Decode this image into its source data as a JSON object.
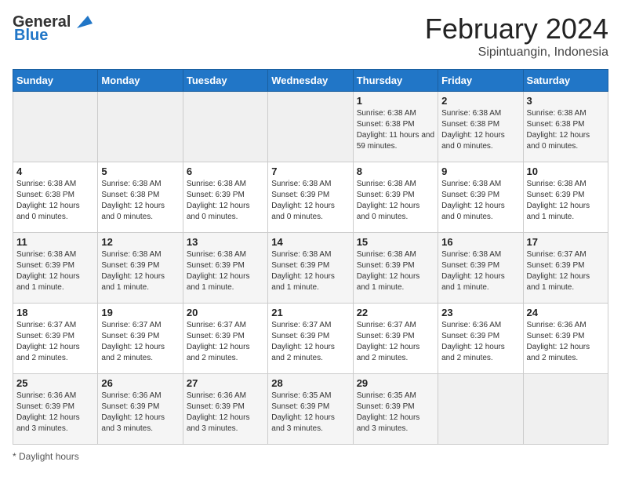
{
  "header": {
    "logo_general": "General",
    "logo_blue": "Blue",
    "month_title": "February 2024",
    "location": "Sipintuangin, Indonesia"
  },
  "days_of_week": [
    "Sunday",
    "Monday",
    "Tuesday",
    "Wednesday",
    "Thursday",
    "Friday",
    "Saturday"
  ],
  "footer": {
    "daylight_label": "Daylight hours"
  },
  "weeks": [
    [
      {
        "day": "",
        "sunrise": "",
        "sunset": "",
        "daylight": "",
        "empty": true
      },
      {
        "day": "",
        "sunrise": "",
        "sunset": "",
        "daylight": "",
        "empty": true
      },
      {
        "day": "",
        "sunrise": "",
        "sunset": "",
        "daylight": "",
        "empty": true
      },
      {
        "day": "",
        "sunrise": "",
        "sunset": "",
        "daylight": "",
        "empty": true
      },
      {
        "day": "1",
        "sunrise": "Sunrise: 6:38 AM",
        "sunset": "Sunset: 6:38 PM",
        "daylight": "Daylight: 11 hours and 59 minutes.",
        "empty": false
      },
      {
        "day": "2",
        "sunrise": "Sunrise: 6:38 AM",
        "sunset": "Sunset: 6:38 PM",
        "daylight": "Daylight: 12 hours and 0 minutes.",
        "empty": false
      },
      {
        "day": "3",
        "sunrise": "Sunrise: 6:38 AM",
        "sunset": "Sunset: 6:38 PM",
        "daylight": "Daylight: 12 hours and 0 minutes.",
        "empty": false
      }
    ],
    [
      {
        "day": "4",
        "sunrise": "Sunrise: 6:38 AM",
        "sunset": "Sunset: 6:38 PM",
        "daylight": "Daylight: 12 hours and 0 minutes.",
        "empty": false
      },
      {
        "day": "5",
        "sunrise": "Sunrise: 6:38 AM",
        "sunset": "Sunset: 6:38 PM",
        "daylight": "Daylight: 12 hours and 0 minutes.",
        "empty": false
      },
      {
        "day": "6",
        "sunrise": "Sunrise: 6:38 AM",
        "sunset": "Sunset: 6:39 PM",
        "daylight": "Daylight: 12 hours and 0 minutes.",
        "empty": false
      },
      {
        "day": "7",
        "sunrise": "Sunrise: 6:38 AM",
        "sunset": "Sunset: 6:39 PM",
        "daylight": "Daylight: 12 hours and 0 minutes.",
        "empty": false
      },
      {
        "day": "8",
        "sunrise": "Sunrise: 6:38 AM",
        "sunset": "Sunset: 6:39 PM",
        "daylight": "Daylight: 12 hours and 0 minutes.",
        "empty": false
      },
      {
        "day": "9",
        "sunrise": "Sunrise: 6:38 AM",
        "sunset": "Sunset: 6:39 PM",
        "daylight": "Daylight: 12 hours and 0 minutes.",
        "empty": false
      },
      {
        "day": "10",
        "sunrise": "Sunrise: 6:38 AM",
        "sunset": "Sunset: 6:39 PM",
        "daylight": "Daylight: 12 hours and 1 minute.",
        "empty": false
      }
    ],
    [
      {
        "day": "11",
        "sunrise": "Sunrise: 6:38 AM",
        "sunset": "Sunset: 6:39 PM",
        "daylight": "Daylight: 12 hours and 1 minute.",
        "empty": false
      },
      {
        "day": "12",
        "sunrise": "Sunrise: 6:38 AM",
        "sunset": "Sunset: 6:39 PM",
        "daylight": "Daylight: 12 hours and 1 minute.",
        "empty": false
      },
      {
        "day": "13",
        "sunrise": "Sunrise: 6:38 AM",
        "sunset": "Sunset: 6:39 PM",
        "daylight": "Daylight: 12 hours and 1 minute.",
        "empty": false
      },
      {
        "day": "14",
        "sunrise": "Sunrise: 6:38 AM",
        "sunset": "Sunset: 6:39 PM",
        "daylight": "Daylight: 12 hours and 1 minute.",
        "empty": false
      },
      {
        "day": "15",
        "sunrise": "Sunrise: 6:38 AM",
        "sunset": "Sunset: 6:39 PM",
        "daylight": "Daylight: 12 hours and 1 minute.",
        "empty": false
      },
      {
        "day": "16",
        "sunrise": "Sunrise: 6:38 AM",
        "sunset": "Sunset: 6:39 PM",
        "daylight": "Daylight: 12 hours and 1 minute.",
        "empty": false
      },
      {
        "day": "17",
        "sunrise": "Sunrise: 6:37 AM",
        "sunset": "Sunset: 6:39 PM",
        "daylight": "Daylight: 12 hours and 1 minute.",
        "empty": false
      }
    ],
    [
      {
        "day": "18",
        "sunrise": "Sunrise: 6:37 AM",
        "sunset": "Sunset: 6:39 PM",
        "daylight": "Daylight: 12 hours and 2 minutes.",
        "empty": false
      },
      {
        "day": "19",
        "sunrise": "Sunrise: 6:37 AM",
        "sunset": "Sunset: 6:39 PM",
        "daylight": "Daylight: 12 hours and 2 minutes.",
        "empty": false
      },
      {
        "day": "20",
        "sunrise": "Sunrise: 6:37 AM",
        "sunset": "Sunset: 6:39 PM",
        "daylight": "Daylight: 12 hours and 2 minutes.",
        "empty": false
      },
      {
        "day": "21",
        "sunrise": "Sunrise: 6:37 AM",
        "sunset": "Sunset: 6:39 PM",
        "daylight": "Daylight: 12 hours and 2 minutes.",
        "empty": false
      },
      {
        "day": "22",
        "sunrise": "Sunrise: 6:37 AM",
        "sunset": "Sunset: 6:39 PM",
        "daylight": "Daylight: 12 hours and 2 minutes.",
        "empty": false
      },
      {
        "day": "23",
        "sunrise": "Sunrise: 6:36 AM",
        "sunset": "Sunset: 6:39 PM",
        "daylight": "Daylight: 12 hours and 2 minutes.",
        "empty": false
      },
      {
        "day": "24",
        "sunrise": "Sunrise: 6:36 AM",
        "sunset": "Sunset: 6:39 PM",
        "daylight": "Daylight: 12 hours and 2 minutes.",
        "empty": false
      }
    ],
    [
      {
        "day": "25",
        "sunrise": "Sunrise: 6:36 AM",
        "sunset": "Sunset: 6:39 PM",
        "daylight": "Daylight: 12 hours and 3 minutes.",
        "empty": false
      },
      {
        "day": "26",
        "sunrise": "Sunrise: 6:36 AM",
        "sunset": "Sunset: 6:39 PM",
        "daylight": "Daylight: 12 hours and 3 minutes.",
        "empty": false
      },
      {
        "day": "27",
        "sunrise": "Sunrise: 6:36 AM",
        "sunset": "Sunset: 6:39 PM",
        "daylight": "Daylight: 12 hours and 3 minutes.",
        "empty": false
      },
      {
        "day": "28",
        "sunrise": "Sunrise: 6:35 AM",
        "sunset": "Sunset: 6:39 PM",
        "daylight": "Daylight: 12 hours and 3 minutes.",
        "empty": false
      },
      {
        "day": "29",
        "sunrise": "Sunrise: 6:35 AM",
        "sunset": "Sunset: 6:39 PM",
        "daylight": "Daylight: 12 hours and 3 minutes.",
        "empty": false
      },
      {
        "day": "",
        "sunrise": "",
        "sunset": "",
        "daylight": "",
        "empty": true
      },
      {
        "day": "",
        "sunrise": "",
        "sunset": "",
        "daylight": "",
        "empty": true
      }
    ]
  ]
}
